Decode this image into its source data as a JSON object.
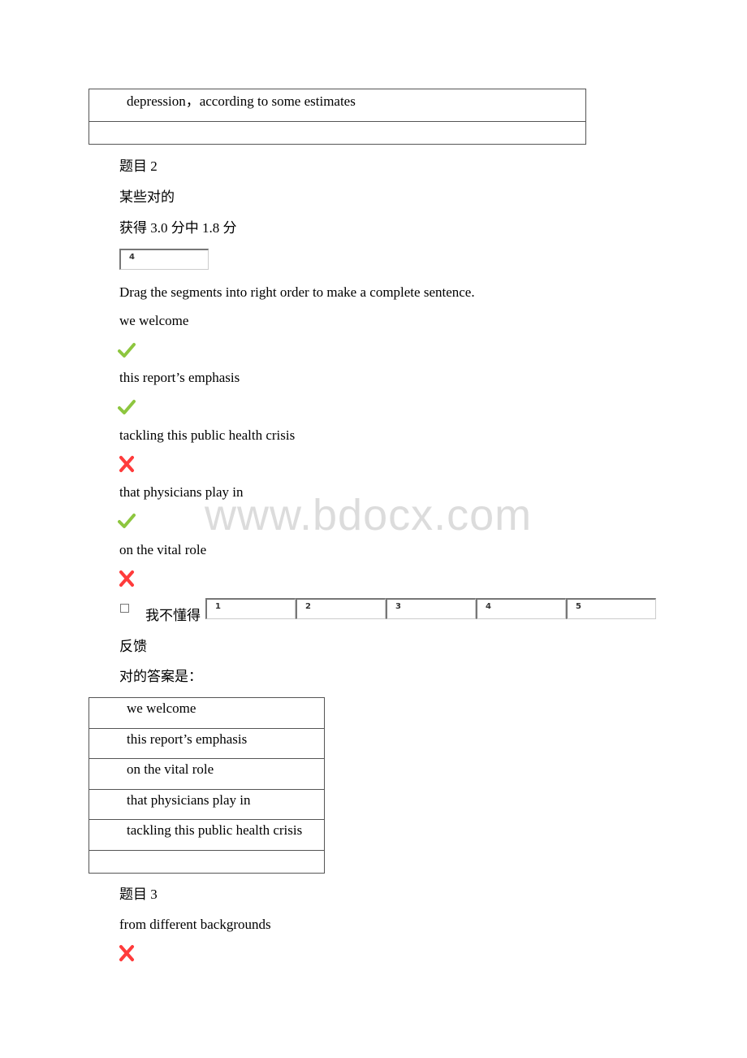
{
  "top_table": {
    "rows": [
      "depression，according to some estimates",
      ""
    ]
  },
  "question2": {
    "title": "题目 2",
    "status": "某些对的",
    "score": "获得 3.0 分中 1.8 分",
    "score_input_value": "4",
    "instruction": "Drag the segments into right order to make a complete sentence.",
    "segments": [
      {
        "text": "we welcome",
        "result": "correct"
      },
      {
        "text": "this report’s emphasis",
        "result": "correct"
      },
      {
        "text": "tackling this public health crisis",
        "result": "incorrect"
      },
      {
        "text": "that physicians play in",
        "result": "correct"
      },
      {
        "text": "on the vital role",
        "result": "incorrect"
      }
    ],
    "dont_know_label": "我不懂得",
    "order_boxes": [
      "1",
      "2",
      "3",
      "4",
      "5"
    ],
    "feedback_label": "反馈",
    "correct_answer_label": "对的答案是：",
    "correct_answer": [
      "we welcome",
      "this report’s emphasis",
      "on the vital role",
      "that physicians play in",
      "tackling this public health crisis",
      ""
    ]
  },
  "question3": {
    "title": "题目 3",
    "segments": [
      {
        "text": "from different backgrounds",
        "result": "incorrect"
      }
    ]
  },
  "watermark": "www.bdocx.com",
  "colors": {
    "correct": "#8dc63f",
    "incorrect": "#ff3b3b",
    "watermark": "#dcdcdc"
  }
}
